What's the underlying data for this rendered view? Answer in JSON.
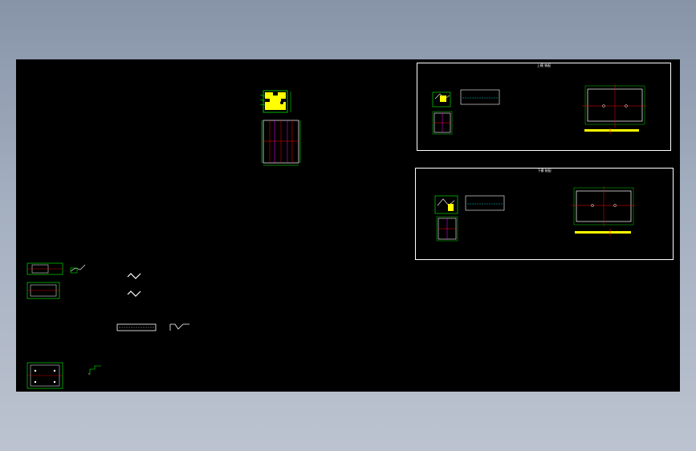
{
  "canvas": {
    "background": "#000000",
    "line_colors": {
      "green": "#00ff00",
      "yellow": "#ffff00",
      "red": "#ff0000",
      "white": "#ffffff",
      "magenta": "#ff00ff",
      "cyan": "#00ffff"
    }
  },
  "frames": {
    "upper": {
      "title": "上模 装配"
    },
    "lower": {
      "title": "下模 装配"
    }
  }
}
